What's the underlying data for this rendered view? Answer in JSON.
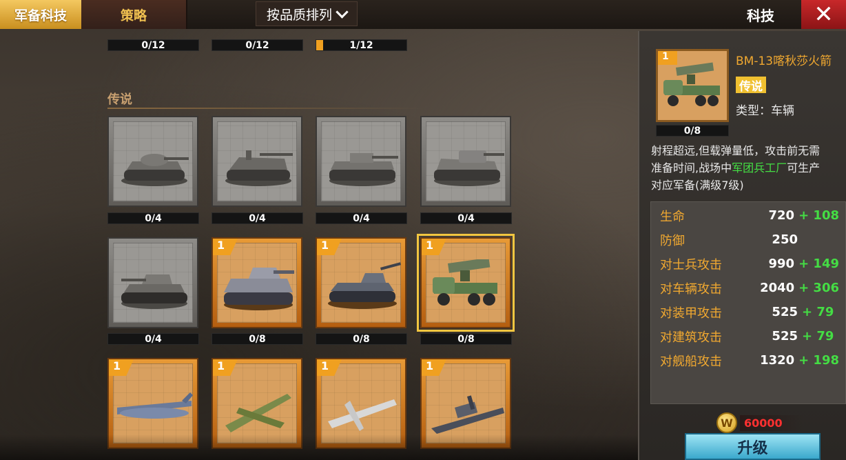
{
  "topbar": {
    "tab_active": "军备科技",
    "tab_strategy": "策略",
    "sort_label": "按品质排列",
    "title": "科技",
    "close_glyph": "✕"
  },
  "top_counters": [
    "0/12",
    "0/12",
    "1/12"
  ],
  "section": {
    "label": "传说"
  },
  "cards": [
    {
      "count": "0/4",
      "level": ""
    },
    {
      "count": "0/4",
      "level": ""
    },
    {
      "count": "0/4",
      "level": ""
    },
    {
      "count": "0/4",
      "level": ""
    },
    {
      "count": "0/4",
      "level": ""
    },
    {
      "count": "0/8",
      "level": "1"
    },
    {
      "count": "0/8",
      "level": "1"
    },
    {
      "count": "0/8",
      "level": "1"
    },
    {
      "count": "",
      "level": "1"
    },
    {
      "count": "",
      "level": "1"
    },
    {
      "count": "",
      "level": "1"
    },
    {
      "count": "",
      "level": "1"
    }
  ],
  "detail": {
    "level": "1",
    "count": "0/8",
    "name": "BM-13喀秋莎火箭",
    "rarity": "传说",
    "type": "类型：车辆",
    "desc_line1": "射程超远,但载弹量低，攻击前无需",
    "desc_line2_pre": "准备时间,战场中",
    "desc_line2_hl": "军团兵工厂",
    "desc_line2_post": "可生产",
    "desc_line3": "对应军备(满级7级)",
    "stats": [
      {
        "label": "生命",
        "value": "720",
        "bonus": "+ 108"
      },
      {
        "label": "防御",
        "value": "250",
        "bonus": ""
      },
      {
        "label": "对士兵攻击",
        "value": "990",
        "bonus": "+ 149"
      },
      {
        "label": "对车辆攻击",
        "value": "2040",
        "bonus": "+ 306"
      },
      {
        "label": "对装甲攻击",
        "value": "525",
        "bonus": "+ 79"
      },
      {
        "label": "对建筑攻击",
        "value": "525",
        "bonus": "+ 79"
      },
      {
        "label": "对舰船攻击",
        "value": "1320",
        "bonus": "+ 198"
      }
    ],
    "cost": "60000",
    "coin_glyph": "W",
    "upgrade_label": "升级"
  }
}
